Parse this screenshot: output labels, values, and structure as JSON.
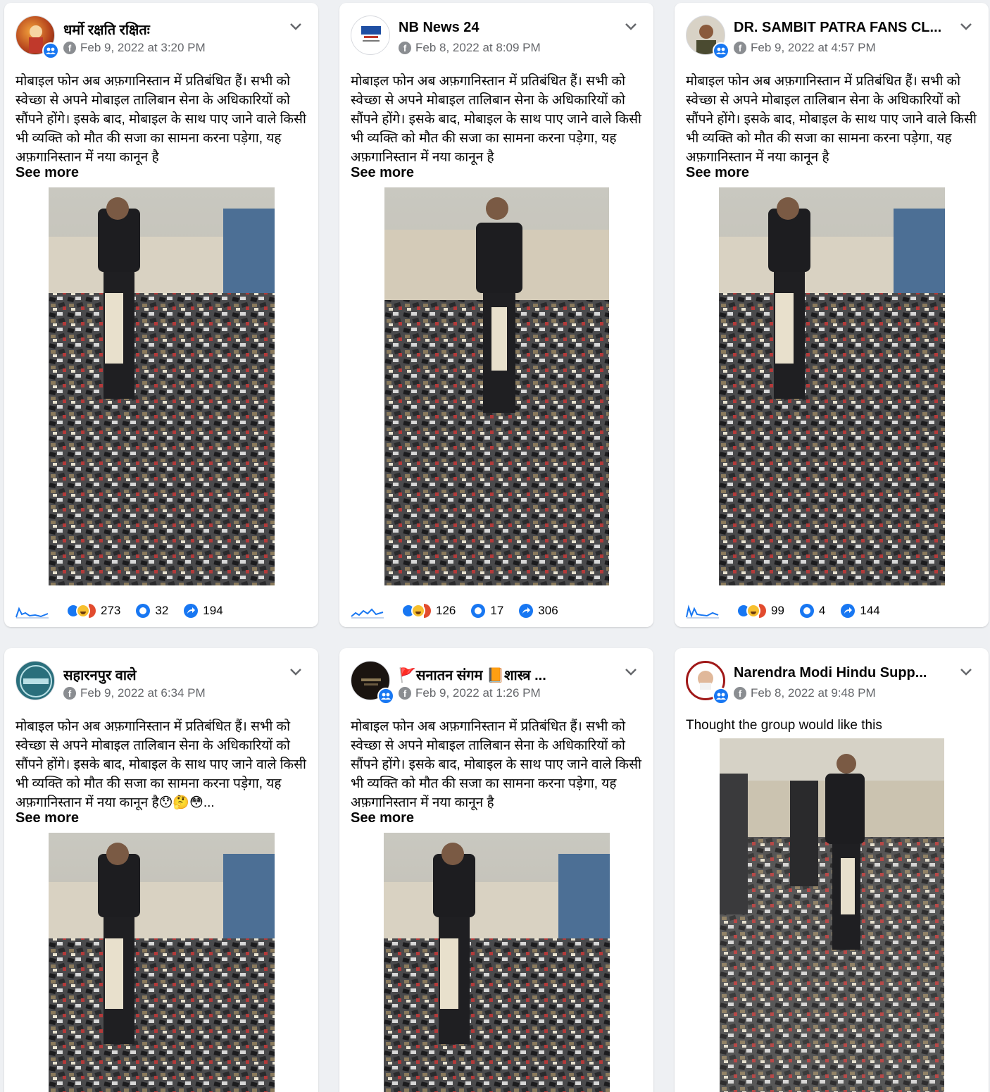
{
  "posts": [
    {
      "page_name": "धर्मो रक्षति रक्षितः",
      "timestamp": "Feb 9, 2022 at 3:20 PM",
      "text": "मोबाइल फोन अब अफ़गानिस्तान में प्रतिबंधित हैं। सभी को स्वेच्छा से अपने मोबाइल तालिबान सेना के अधिकारियों को सौंपने होंगे। इसके बाद, मोबाइल के साथ पाए जाने वाले किसी भी व्यक्ति को मौत की सजा का सामना करना पड़ेगा, यह अफ़गानिस्तान में नया कानून है",
      "see_more": "See more",
      "reactions": "273",
      "comments": "32",
      "shares": "194"
    },
    {
      "page_name": "NB News 24",
      "timestamp": "Feb 8, 2022 at 8:09 PM",
      "text": "मोबाइल फोन अब अफ़गानिस्तान में प्रतिबंधित हैं। सभी को स्वेच्छा से अपने मोबाइल तालिबान सेना के अधिकारियों को सौंपने होंगे। इसके बाद, मोबाइल के साथ पाए जाने वाले किसी भी व्यक्ति को मौत की सजा का सामना करना पड़ेगा, यह अफ़गानिस्तान में नया कानून है",
      "see_more": "See more",
      "reactions": "126",
      "comments": "17",
      "shares": "306"
    },
    {
      "page_name": "DR. SAMBIT PATRA FANS CL...",
      "timestamp": "Feb 9, 2022 at 4:57 PM",
      "text": "मोबाइल फोन अब अफ़गानिस्तान में प्रतिबंधित हैं। सभी को स्वेच्छा से अपने मोबाइल तालिबान सेना के अधिकारियों को सौंपने होंगे। इसके बाद, मोबाइल के साथ पाए जाने वाले किसी भी व्यक्ति को मौत की सजा का सामना करना पड़ेगा, यह अफ़गानिस्तान में नया कानून है",
      "see_more": "See more",
      "reactions": "99",
      "comments": "4",
      "shares": "144"
    },
    {
      "page_name": "सहारनपुर वाले",
      "timestamp": "Feb 9, 2022 at 6:34 PM",
      "text": "मोबाइल फोन अब अफ़गानिस्तान में प्रतिबंधित हैं। सभी को स्वेच्छा से अपने मोबाइल तालिबान सेना के अधिकारियों को सौंपने होंगे। इसके बाद, मोबाइल के साथ पाए जाने वाले किसी भी व्यक्ति को मौत की सजा का सामना करना पड़ेगा, यह अफ़गानिस्तान में नया कानून है😯🤔😳...",
      "see_more": "See more"
    },
    {
      "page_name": "🚩सनातन संगम 📙शास्त्र ...",
      "timestamp": "Feb 9, 2022 at 1:26 PM",
      "text": "मोबाइल फोन अब अफ़गानिस्तान में प्रतिबंधित हैं। सभी को स्वेच्छा से अपने मोबाइल तालिबान सेना के अधिकारियों को सौंपने होंगे। इसके बाद, मोबाइल के साथ पाए जाने वाले किसी भी व्यक्ति को मौत की सजा का सामना करना पड़ेगा, यह अफ़गानिस्तान में नया कानून है",
      "see_more": "See more"
    },
    {
      "page_name": "Narendra Modi Hindu Supp...",
      "timestamp": "Feb 8, 2022 at 9:48 PM",
      "text": "Thought the group would like this"
    }
  ],
  "colors": {
    "background": "#eef0f3",
    "card": "#ffffff",
    "accent": "#1877f2",
    "muted_text": "#65676b"
  }
}
